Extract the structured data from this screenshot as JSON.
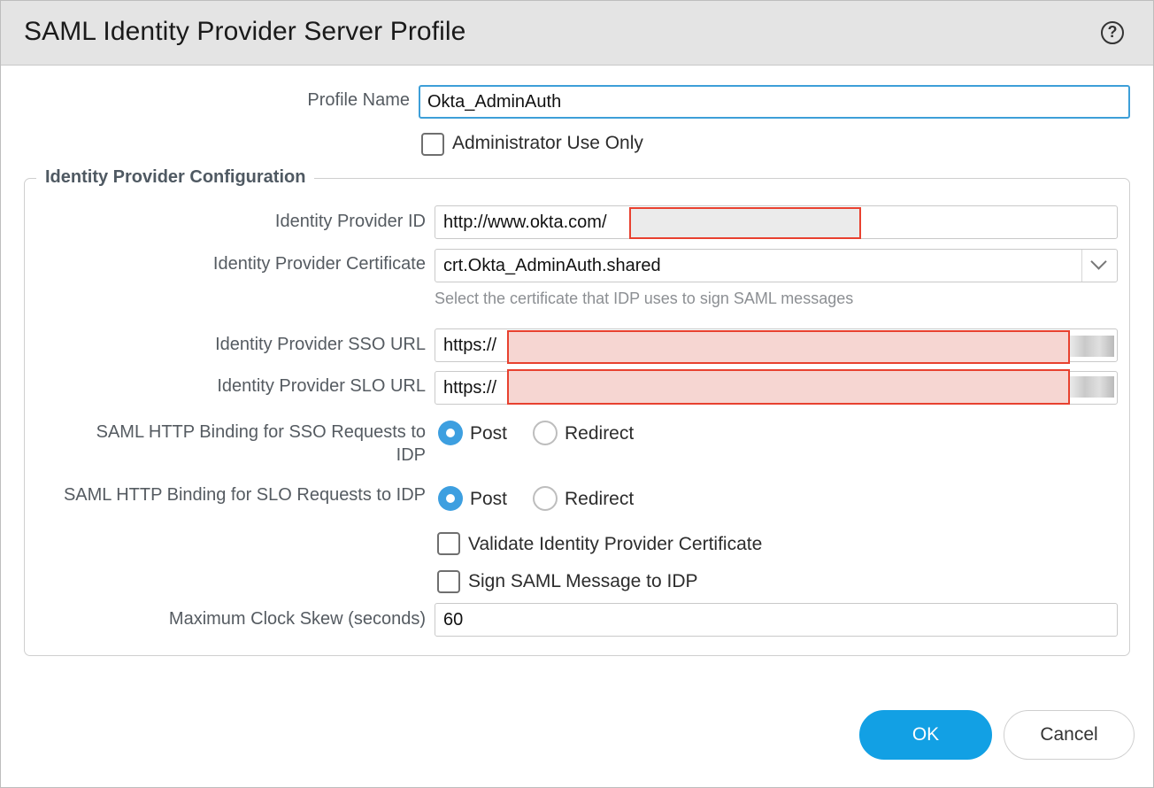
{
  "dialog": {
    "title": "SAML Identity Provider Server Profile",
    "help_label": "?"
  },
  "profile": {
    "name_label": "Profile Name",
    "name_value": "Okta_AdminAuth",
    "admin_only_label": "Administrator Use Only",
    "admin_only_checked": false
  },
  "idp_config": {
    "legend": "Identity Provider Configuration",
    "idp_id_label": "Identity Provider ID",
    "idp_id_value": "http://www.okta.com/",
    "cert_label": "Identity Provider Certificate",
    "cert_value": "crt.Okta_AdminAuth.shared",
    "cert_hint": "Select the certificate that IDP uses to sign SAML messages",
    "sso_url_label": "Identity Provider SSO URL",
    "sso_url_value": "https://",
    "slo_url_label": "Identity Provider SLO URL",
    "slo_url_value": "https://",
    "sso_binding_label_line1": "SAML HTTP Binding for SSO Requests to",
    "sso_binding_label_line2": "IDP",
    "sso_binding_options": [
      "Post",
      "Redirect"
    ],
    "sso_binding_selected": "Post",
    "slo_binding_label": "SAML HTTP Binding for SLO Requests to IDP",
    "slo_binding_options": [
      "Post",
      "Redirect"
    ],
    "slo_binding_selected": "Post",
    "validate_cert_label": "Validate Identity Provider Certificate",
    "validate_cert_checked": false,
    "sign_message_label": "Sign SAML Message to IDP",
    "sign_message_checked": false,
    "clock_skew_label": "Maximum Clock Skew (seconds)",
    "clock_skew_value": "60"
  },
  "footer": {
    "ok_label": "OK",
    "cancel_label": "Cancel"
  },
  "colors": {
    "accent": "#12a0e4",
    "radio_selected": "#3d9fe0",
    "title_bar": "#e4e4e4",
    "redaction_border": "#e8412f"
  }
}
